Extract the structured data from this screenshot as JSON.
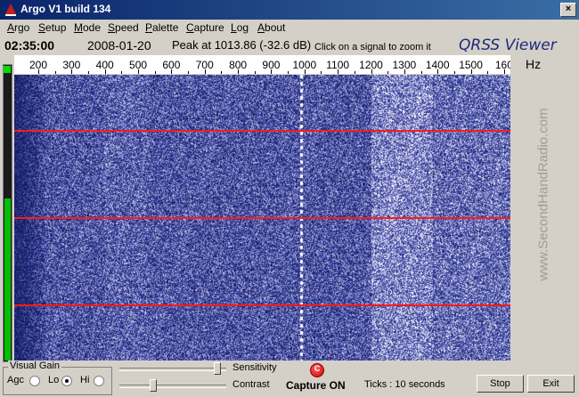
{
  "window": {
    "title": "Argo V1 build 134",
    "close_glyph": "×"
  },
  "menu": [
    {
      "u": "A",
      "rest": "rgo"
    },
    {
      "u": "S",
      "rest": "etup"
    },
    {
      "u": "M",
      "rest": "ode"
    },
    {
      "u": "S",
      "rest": "peed"
    },
    {
      "u": "P",
      "rest": "alette"
    },
    {
      "u": "C",
      "rest": "apture"
    },
    {
      "u": "L",
      "rest": "og"
    },
    {
      "u": "A",
      "rest": "bout"
    }
  ],
  "info": {
    "time": "02:35:00",
    "date": "2008-01-20",
    "peak": "Peak at 1013.86 (-32.6 dB)",
    "hint": "Click on a signal to zoom it",
    "brand": "QRSS Viewer"
  },
  "ruler": {
    "ticks": [
      "200",
      "300",
      "400",
      "500",
      "600",
      "700",
      "800",
      "900",
      "1000",
      "1100",
      "1200",
      "1300",
      "1400",
      "1500",
      "160"
    ],
    "unit": "Hz"
  },
  "watermark": "www.SecondHandRadio.com",
  "level_meter": {
    "level_fraction": 0.55
  },
  "visual_gain": {
    "legend": "Visual Gain",
    "agc_label": "Agc",
    "lo_label": "Lo",
    "hi_label": "Hi",
    "selected": "Lo"
  },
  "sliders": {
    "sensitivity": {
      "label": "Sensitivity",
      "value": 0.95
    },
    "contrast": {
      "label": "Contrast",
      "value": 0.3
    }
  },
  "capture": {
    "led_label": "C",
    "status": "Capture ON"
  },
  "ticks_text": "Ticks   : 10 seconds",
  "buttons": {
    "stop": "Stop",
    "exit": "Exit"
  },
  "colors": {
    "marker_line": "#ff1a1a",
    "waterfall_bg": "#1a2a70",
    "titlebar": "#0a246a"
  }
}
